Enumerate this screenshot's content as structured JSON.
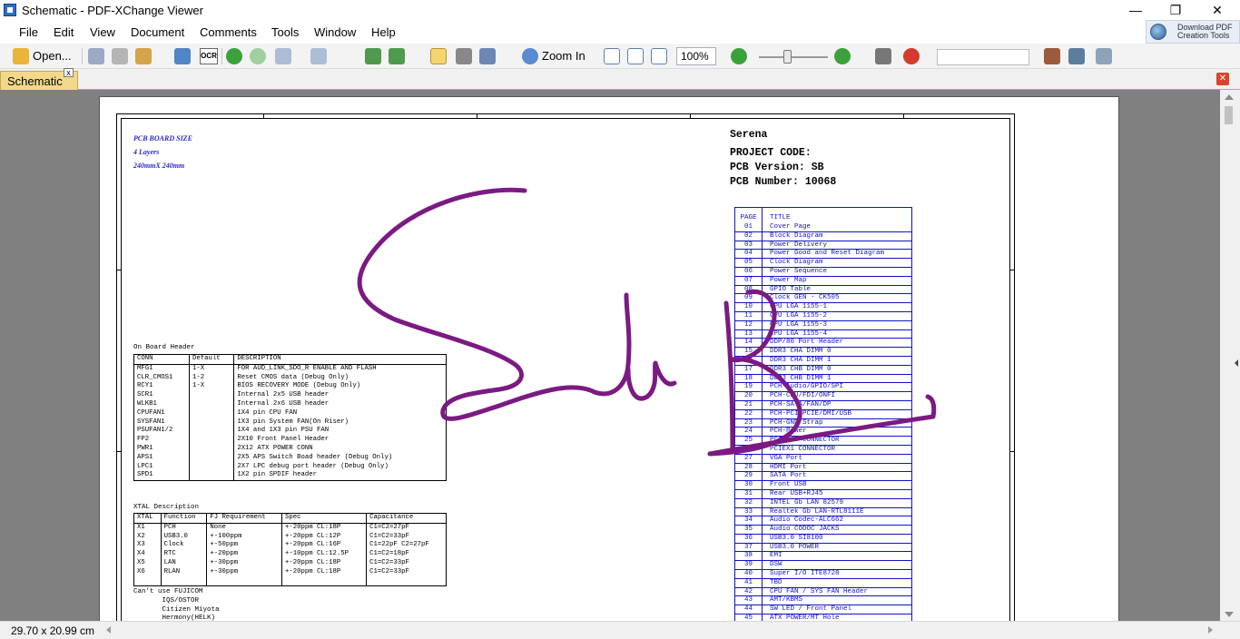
{
  "window": {
    "title": "Schematic - PDF-XChange Viewer",
    "minimize_glyph": "—",
    "restore_glyph": "❐",
    "close_glyph": "✕"
  },
  "menu": [
    "File",
    "Edit",
    "View",
    "Document",
    "Comments",
    "Tools",
    "Window",
    "Help"
  ],
  "download_button": {
    "line1": "Download PDF",
    "line2": "Creation Tools"
  },
  "toolbar": {
    "open_label": "Open...",
    "ocr_label": "OCR",
    "zoom_in_label": "Zoom In",
    "zoom_value": "100%",
    "search_placeholder": "",
    "zoom_slider_fraction": 0.42,
    "icons": [
      "open-icon",
      "save-icon",
      "print-icon",
      "email-icon",
      "scan-icon",
      "ocr-icon",
      "back-icon",
      "forward-icon",
      "undo-icon",
      "redo-icon",
      "rotate-icon",
      "hand-tool-icon",
      "snapshot-icon",
      "select-text-icon",
      "zoom-in-icon",
      "actual-size-icon",
      "fit-page-icon",
      "fit-width-icon",
      "zoom-out-icon",
      "zoom-plus-icon",
      "find-icon",
      "spell-check-icon",
      "properties-icon"
    ]
  },
  "tab": {
    "label": "Schematic",
    "close_glyph": "x"
  },
  "colors": {
    "accent_tab": "#f3d88a",
    "link_blue": "#1212c4",
    "ink": "#7b1a82"
  },
  "status": {
    "page_size": "29.70 x 20.99 cm"
  },
  "document": {
    "board": {
      "line1": "PCB BOARD SIZE",
      "line2": "4 Layers",
      "line3": "240mmX 240mm"
    },
    "project": {
      "name": "Serena",
      "code": "PROJECT CODE:",
      "version": "PCB Version: SB",
      "number": "PCB Number: 10068"
    },
    "header_title": "On Board Header",
    "header_table": {
      "columns": [
        "CONN",
        "Default",
        "DESCRIPTION"
      ],
      "rows": [
        [
          "MFG1",
          "1-X",
          "FOR AUD_LINK_SDO_R ENABLE AND FLASH"
        ],
        [
          "CLR_CMOS1",
          "1-2",
          "Reset CMOS data  (Debug Only)"
        ],
        [
          "RCY1",
          "1-X",
          "BIOS RECOVERY MODE  (Debug Only)"
        ],
        [
          "SCR1",
          "",
          "Internal 2x5 USB header"
        ],
        [
          "WLKB1",
          "",
          "Internal 2x6 USB header"
        ],
        [
          "CPUFAN1",
          "",
          "1X4 pin CPU FAN"
        ],
        [
          "SYSFAN1",
          "",
          "1X3 pin System FAN(On Riser)"
        ],
        [
          "PSUFAN1/2",
          "",
          "1X4 and 1X3 pin PSU FAN"
        ],
        [
          "FP2",
          "",
          "2X10 Front Panel Header"
        ],
        [
          "PWR1",
          "",
          "2X12 ATX POWER CONN"
        ],
        [
          "APS1",
          "",
          "2X5 APS Switch Boad header  (Debug Only)"
        ],
        [
          "LPC1",
          "",
          "2X7 LPC debug port header  (Debug Only)"
        ],
        [
          "SPD1",
          "",
          "1X2 pin SPDIF header"
        ]
      ]
    },
    "xtal_title": "XTAL Description",
    "xtal_table": {
      "columns": [
        "XTAL",
        "Function",
        "FJ Requirement",
        "Spec",
        "Capacitance"
      ],
      "rows": [
        [
          "X1",
          "PCH",
          "None",
          "+-20ppm CL:18P",
          "C1=C2=27pF"
        ],
        [
          "X2",
          "USB3.0",
          "+-100ppm",
          "+-20ppm CL:12P",
          "C1=C2=33pF"
        ],
        [
          "X3",
          "Clock",
          "+-50ppm",
          "+-20ppm CL:16P",
          "C1=22pF C2=27pF"
        ],
        [
          "X4",
          "RTC",
          "+-20ppm",
          "+-10ppm CL:12.5P",
          "C1=C2=18pF"
        ],
        [
          "X5",
          "LAN",
          "+-30ppm",
          "+-20ppm CL:18P",
          "C1=C2=33pF"
        ],
        [
          "X6",
          "RLAN",
          "+-30ppm",
          "+-20ppm CL:18P",
          "C1=C2=33pF"
        ],
        [
          "",
          "",
          "",
          "",
          ""
        ]
      ]
    },
    "note": "Can't use FUJICOM\n       IQS/OSTOR\n       Citizen Miyota\n       Hermony(HELK)",
    "index_header": {
      "page": "PAGE",
      "title": "TITLE"
    },
    "index": [
      [
        "01",
        "Cover Page"
      ],
      [
        "02",
        "Block Diagram"
      ],
      [
        "03",
        "Power Delivery"
      ],
      [
        "04",
        "Power Good and Reset Diagram"
      ],
      [
        "05",
        "Clock Diagram"
      ],
      [
        "06",
        "Power Sequence"
      ],
      [
        "07",
        "Power Map"
      ],
      [
        "08",
        "GPIO Table"
      ],
      [
        "09",
        "Clock GEN - CK505"
      ],
      [
        "10",
        "CPU LGA 1155-1"
      ],
      [
        "11",
        "CPU LGA 1155-2"
      ],
      [
        "12",
        "CPU LGA 1155-3"
      ],
      [
        "13",
        "CPU LGA 1155-4"
      ],
      [
        "14",
        "DDP/80 Port Header"
      ],
      [
        "15",
        "DDR3 CHA DIMM 0"
      ],
      [
        "16",
        "DDR3 CHA DIMM 1"
      ],
      [
        "17",
        "DDR3 CHB DIMM 0"
      ],
      [
        "18",
        "DDR3 CHB DIMM 1"
      ],
      [
        "19",
        "PCH-Audio/GPIO/SPI"
      ],
      [
        "20",
        "PCH-CPU/FDI/ONFI"
      ],
      [
        "21",
        "PCH-SATA/FAN/DP"
      ],
      [
        "22",
        "PCH-PCI/PCIE/DMI/USB"
      ],
      [
        "23",
        "PCH-GND/Strap"
      ],
      [
        "24",
        "PCH-Power"
      ],
      [
        "25",
        "PCIEX16 CONNECTOR"
      ],
      [
        "26",
        "PCIEX1 CONNECTOR"
      ],
      [
        "27",
        "VGA Port"
      ],
      [
        "28",
        "HDMI Port"
      ],
      [
        "29",
        "SATA Port"
      ],
      [
        "30",
        "Front USB"
      ],
      [
        "31",
        "Rear USB+RJ45"
      ],
      [
        "32",
        "INTEL Gb LAN 82579"
      ],
      [
        "33",
        "Realtek Gb LAN-RTL8111E"
      ],
      [
        "34",
        "Audio Codec-ALC662"
      ],
      [
        "35",
        "Audio CODOC JACKS"
      ],
      [
        "36",
        "USB3.0 SI8100"
      ],
      [
        "37",
        "USB3.0 POWER"
      ],
      [
        "38",
        "EMI"
      ],
      [
        "39",
        "DSW"
      ],
      [
        "40",
        "Super I/O ITE8728"
      ],
      [
        "41",
        "TBD"
      ],
      [
        "42",
        "CPU FAN / SYS FAN Header"
      ],
      [
        "43",
        "AMT/KBMS"
      ],
      [
        "44",
        "SW LED / Front Panel"
      ],
      [
        "45",
        "ATX POWER/MT Hole"
      ]
    ]
  }
}
